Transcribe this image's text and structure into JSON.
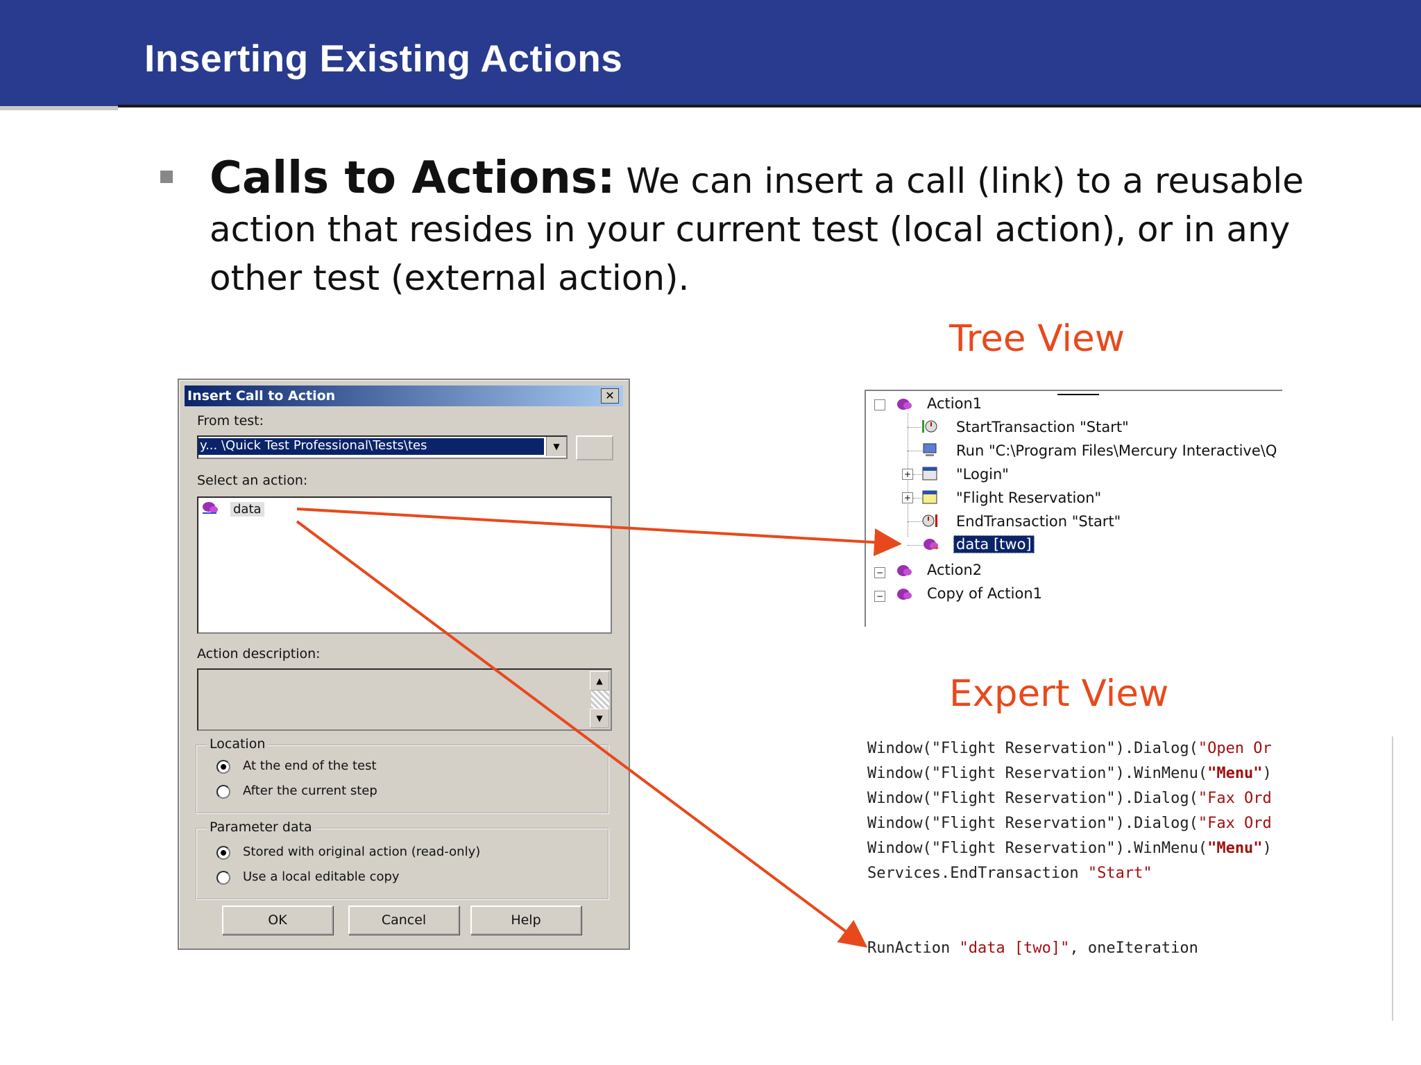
{
  "slide": {
    "title": "Inserting Existing Actions",
    "bullet_bold": "Calls to Actions:",
    "bullet_text": " We can insert a call (link) to a reusable action that resides in your current test (local action), or in any other test (external action)."
  },
  "labels": {
    "tree_view": "Tree View",
    "expert_view": "Expert View"
  },
  "dialog": {
    "caption": "Insert Call to Action",
    "close": "✕",
    "from_test_label": "From test:",
    "from_test_value": "y... \\Quick Test Professional\\Tests\\tes",
    "select_action_label": "Select an action:",
    "action_item": "data",
    "action_description_label": "Action description:",
    "location_title": "Location",
    "location_opt1": "At the end of the test",
    "location_opt2": "After the current step",
    "parameter_title": "Parameter data",
    "param_opt1": "Stored with original action (read-only)",
    "param_opt2": "Use a local editable copy",
    "ok": "OK",
    "cancel": "Cancel",
    "help": "Help"
  },
  "tree": {
    "rows": [
      "Action1",
      "StartTransaction \"Start\"",
      "Run \"C:\\Program Files\\Mercury Interactive\\Q",
      "\"Login\"",
      "\"Flight Reservation\"",
      "EndTransaction \"Start\"",
      "data [two]",
      "Action2",
      "Copy of Action1"
    ]
  },
  "expert": {
    "lines": [
      {
        "a": "Window(\"Flight Reservation\").Dialog(",
        "b": "\"Open Or",
        "c": ""
      },
      {
        "a": "Window(\"Flight Reservation\").WinMenu(",
        "b": "\"Menu\"",
        "c": ")"
      },
      {
        "a": "Window(\"Flight Reservation\").Dialog(",
        "b": "\"Fax Ord",
        "c": ""
      },
      {
        "a": "Window(\"Flight Reservation\").Dialog(",
        "b": "\"Fax Ord",
        "c": ""
      },
      {
        "a": "Window(\"Flight Reservation\").WinMenu(",
        "b": "\"Menu\"",
        "c": ")"
      },
      {
        "a": "Services.EndTransaction ",
        "b": "\"Start\"",
        "c": ""
      }
    ],
    "run_line_a": "RunAction ",
    "run_line_b": "\"data [two]\"",
    "run_line_c": ", oneIteration"
  },
  "colors": {
    "title_bar": "#283b8e",
    "accent": "#e8491c"
  }
}
